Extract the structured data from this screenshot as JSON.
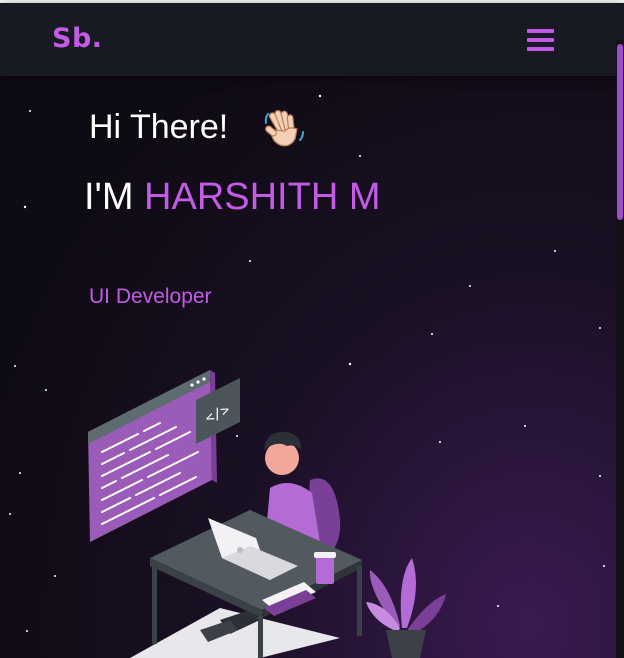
{
  "navbar": {
    "logo": "Sb.",
    "menu_icon": "hamburger-menu-icon"
  },
  "hero": {
    "greeting": "Hi There!",
    "wave_icon": "waving-hand-icon",
    "intro_prefix": "I'M",
    "name": "HARSHITH M",
    "role": "UI Developer"
  },
  "colors": {
    "accent": "#c35be7",
    "navbar_bg": "#181a23",
    "page_bg": "#0f0b14",
    "text": "#ffffff"
  }
}
